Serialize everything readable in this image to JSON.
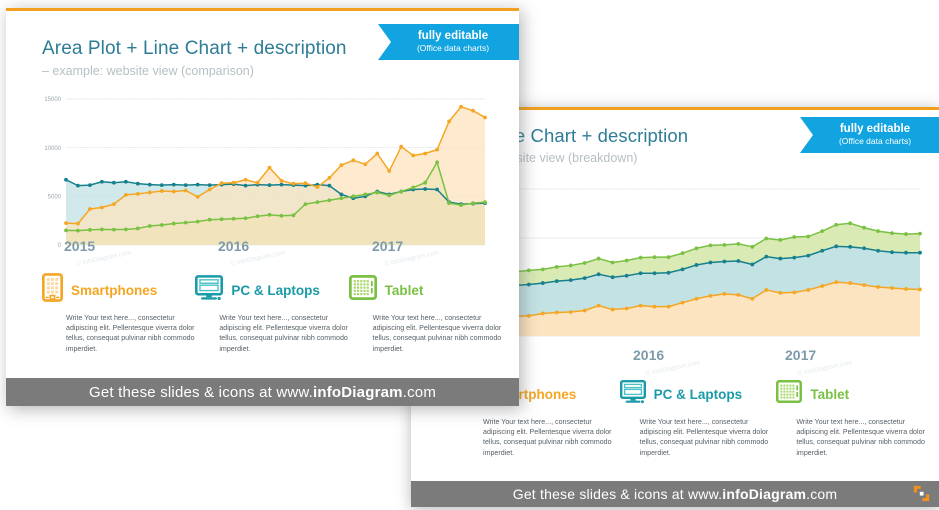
{
  "meta": {
    "brand_orange": "#f5a623",
    "brand_teal": "#1b9aa8",
    "brand_green": "#7ac143",
    "ribbon_blue": "#12a4e0",
    "title_blue": "#2e7d96",
    "footer_gray": "#7b7b7b"
  },
  "ribbon": {
    "line1": "fully editable",
    "line2": "(Office data charts)"
  },
  "front_slide": {
    "title": "Area Plot + Line Chart + description",
    "subtitle": "– example: website view (comparison)",
    "watermark": "© infoDiagram.com",
    "footer_prefix": "Get these slides & icons at www.",
    "footer_brand": "infoDiagram",
    "footer_suffix": ".com"
  },
  "back_slide": {
    "title": "Area + Line Chart + description",
    "subtitle": "– example: website view (breakdown)",
    "watermark": "© infoDiagram.com",
    "footer_prefix": "Get these slides & icons at www.",
    "footer_brand": "infoDiagram",
    "footer_suffix": ".com"
  },
  "legend": [
    {
      "icon": "smartphone-icon",
      "name": "Smartphones",
      "color": "#f5a623",
      "text": "Write Your text here..., consectetur adipiscing elit. Pellentesque viverra dolor tellus, consequat pulvinar nibh commodo imperdiet."
    },
    {
      "icon": "desktop-monitor-icon",
      "name": "PC & Laptops",
      "color": "#1b9aa8",
      "text": "Write Your text here..., consectetur adipiscing elit. Pellentesque viverra dolor tellus, consequat pulvinar nibh commodo imperdiet."
    },
    {
      "icon": "tablet-icon",
      "name": "Tablet",
      "color": "#7ac143",
      "text": "Write Your text here..., consectetur adipiscing elit. Pellentesque viverra dolor tellus, consequat pulvinar nibh commodo imperdiet."
    }
  ],
  "chart_data": [
    {
      "id": "front-chart",
      "type": "area",
      "stacked": false,
      "title": "Area Plot + Line Chart + description",
      "xlabel": "",
      "ylabel": "",
      "ylim": [
        0,
        15000
      ],
      "yticks": [
        0,
        5000,
        10000,
        15000
      ],
      "ytick_labels": [
        "0",
        "5000",
        "10000",
        "15000"
      ],
      "grid": true,
      "legend_position": "below",
      "x_group_labels": [
        "2015",
        "2016",
        "2017"
      ],
      "x": [
        1,
        2,
        3,
        4,
        5,
        6,
        7,
        8,
        9,
        10,
        11,
        12,
        13,
        14,
        15,
        16,
        17,
        18,
        19,
        20,
        21,
        22,
        23,
        24,
        25,
        26,
        27,
        28,
        29,
        30,
        31,
        32,
        33,
        34,
        35,
        36
      ],
      "series": [
        {
          "name": "PC & Laptops",
          "color": "#17808c",
          "fill": "#bfe0e3",
          "values": [
            6700,
            6100,
            6150,
            6500,
            6400,
            6500,
            6300,
            6200,
            6150,
            6200,
            6150,
            6200,
            6150,
            6200,
            6250,
            6100,
            6200,
            6150,
            6200,
            6150,
            6100,
            6200,
            6100,
            5200,
            4800,
            5000,
            5500,
            5200,
            5500,
            5700,
            5750,
            5700,
            4400,
            4200,
            4250,
            4300
          ]
        },
        {
          "name": "Smartphones",
          "color": "#f5a623",
          "fill": "#fde3bd",
          "values": [
            2250,
            2200,
            3700,
            3850,
            4200,
            5150,
            5250,
            5400,
            5550,
            5500,
            5600,
            4950,
            5700,
            6350,
            6400,
            6700,
            6400,
            7950,
            6600,
            6300,
            6350,
            5950,
            6900,
            8200,
            8700,
            8300,
            9400,
            7600,
            10100,
            9200,
            9400,
            9800,
            12700,
            14200,
            13800,
            13100
          ]
        },
        {
          "name": "Tablet",
          "color": "#7ac143",
          "fill": "#cfe3a6",
          "values": [
            1500,
            1480,
            1560,
            1600,
            1580,
            1600,
            1700,
            1950,
            2050,
            2200,
            2300,
            2400,
            2600,
            2650,
            2700,
            2750,
            2950,
            3100,
            3000,
            3050,
            4200,
            4400,
            4600,
            4800,
            5000,
            5200,
            5400,
            5100,
            5500,
            5900,
            6400,
            8500,
            4300,
            4100,
            4300,
            4400
          ]
        }
      ]
    },
    {
      "id": "back-chart",
      "type": "area",
      "stacked": true,
      "title": "Area + Line Chart + description",
      "xlabel": "",
      "ylabel": "",
      "ylim": [
        0,
        15000
      ],
      "grid": true,
      "legend_position": "below",
      "x_group_labels": [
        "2016",
        "2017"
      ],
      "x": [
        1,
        2,
        3,
        4,
        5,
        6,
        7,
        8,
        9,
        10,
        11,
        12,
        13,
        14,
        15,
        16,
        17,
        18,
        19,
        20,
        21,
        22,
        23,
        24,
        25,
        26,
        27,
        28,
        29,
        30,
        31,
        32,
        33,
        34,
        35,
        36
      ],
      "series": [
        {
          "name": "Smartphones",
          "color": "#f5a623",
          "fill": "#fde3bd",
          "values": [
            1500,
            1700,
            1800,
            1900,
            1950,
            2000,
            2000,
            2050,
            2300,
            2400,
            2450,
            2600,
            3100,
            2700,
            2800,
            3100,
            3000,
            3000,
            3400,
            3800,
            4100,
            4300,
            4200,
            3800,
            4700,
            4400,
            4450,
            4700,
            5100,
            5500,
            5400,
            5200,
            5000,
            4900,
            4800,
            4750
          ]
        },
        {
          "name": "PC & Laptops",
          "color": "#17808c",
          "fill": "#bfe0e3",
          "values": [
            3100,
            3000,
            3050,
            3050,
            3100,
            3100,
            3150,
            3200,
            3100,
            3200,
            3250,
            3300,
            3200,
            3300,
            3350,
            3300,
            3400,
            3450,
            3400,
            3450,
            3400,
            3300,
            3450,
            3500,
            3400,
            3500,
            3550,
            3500,
            3600,
            3650,
            3700,
            3750,
            3700,
            3650,
            3700,
            3750
          ]
        },
        {
          "name": "Tablet",
          "color": "#7ac143",
          "fill": "#d7e9b0",
          "values": [
            1200,
            1250,
            1300,
            1300,
            1350,
            1350,
            1400,
            1450,
            1400,
            1450,
            1500,
            1550,
            1600,
            1500,
            1550,
            1600,
            1650,
            1600,
            1650,
            1700,
            1750,
            1700,
            1750,
            1800,
            1850,
            1900,
            2100,
            1950,
            2000,
            2200,
            2400,
            2100,
            2000,
            1950,
            1900,
            1950
          ]
        }
      ]
    }
  ]
}
